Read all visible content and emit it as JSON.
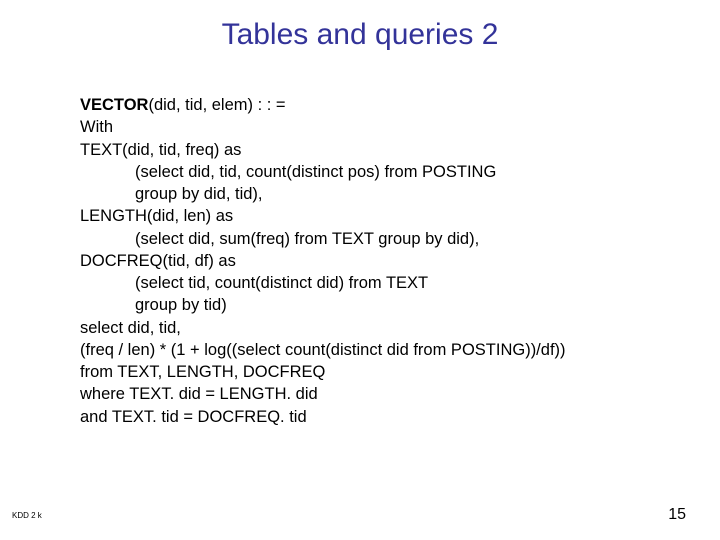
{
  "title": "Tables and queries 2",
  "code": {
    "l1a": "VECTOR",
    "l1b": "(did, tid, elem) : : =",
    "l2": "With",
    "l3": "TEXT(did, tid, freq) as",
    "l4": "            (select did, tid, count(distinct pos) from POSTING",
    "l5": "            group by did, tid),",
    "l6": "LENGTH(did, len) as",
    "l7": "            (select did, sum(freq) from TEXT group by did),",
    "l8": "DOCFREQ(tid, df) as",
    "l9": "            (select tid, count(distinct did) from TEXT",
    "l10": "            group by tid)",
    "l11": "select did, tid,",
    "l12": "(freq / len) * (1 + log((select count(distinct did from POSTING))/df))",
    "l13": "from TEXT, LENGTH, DOCFREQ",
    "l14": "where TEXT. did = LENGTH. did",
    "l15": "and TEXT. tid = DOCFREQ. tid"
  },
  "footer_left": "KDD 2 k",
  "footer_right": "15"
}
